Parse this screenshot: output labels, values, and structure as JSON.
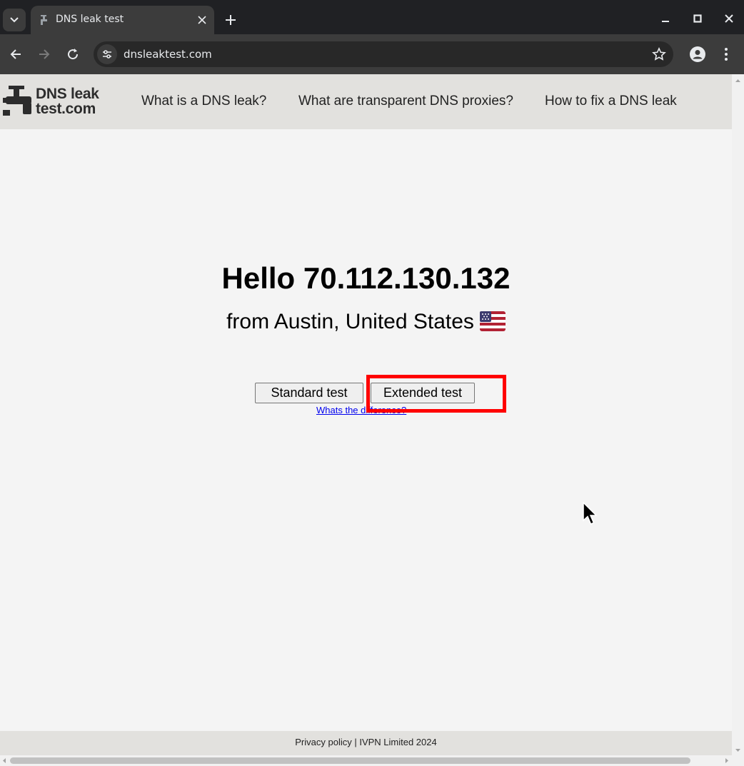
{
  "browser": {
    "tab_title": "DNS leak test",
    "url": "dnsleaktest.com"
  },
  "site": {
    "logo_line1": "DNS leak",
    "logo_line2": "test.com",
    "nav": [
      "What is a DNS leak?",
      "What are transparent DNS proxies?",
      "How to fix a DNS leak"
    ]
  },
  "main": {
    "greeting": "Hello 70.112.130.132",
    "location": "from Austin, United States",
    "flag_icon": "us-flag-icon",
    "standard_button": "Standard test",
    "extended_button": "Extended test",
    "difference_link": "Whats the difference?"
  },
  "footer": {
    "text": "Privacy policy | IVPN Limited 2024"
  },
  "colors": {
    "highlight": "#ff0000",
    "header_bg": "#e2e1de",
    "link": "#0000ee"
  }
}
